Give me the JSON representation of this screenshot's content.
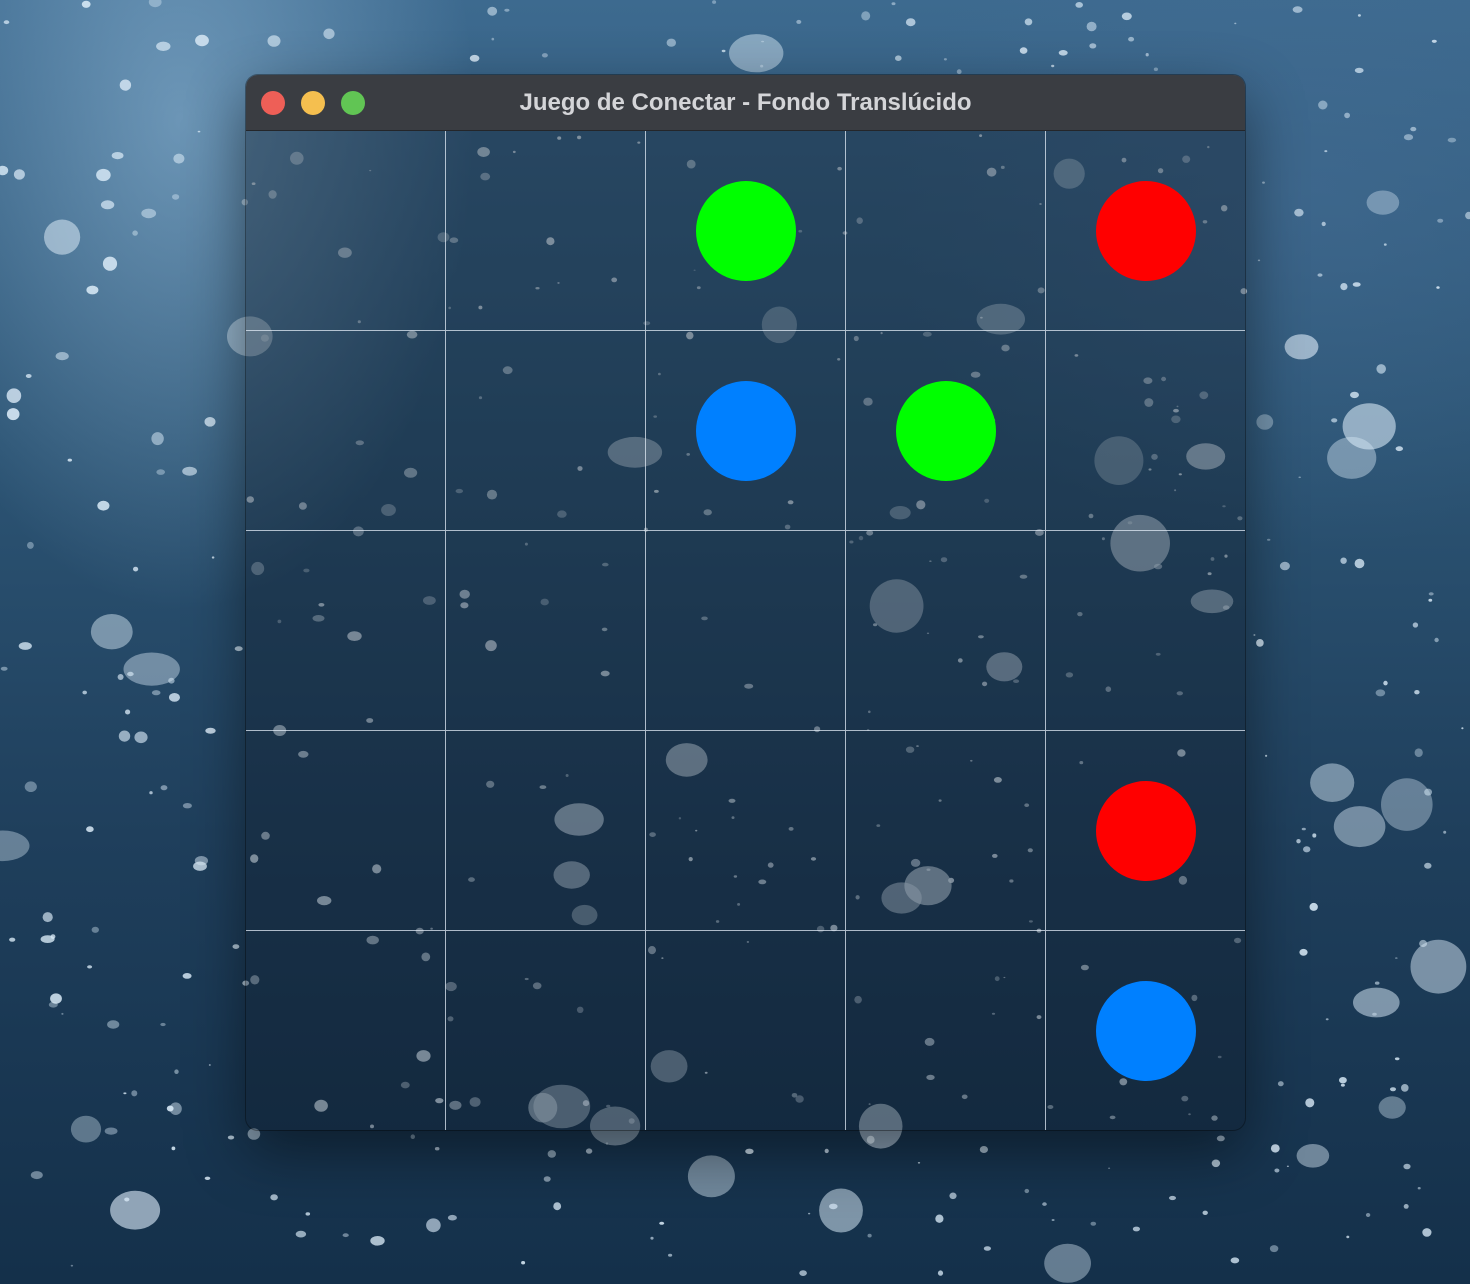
{
  "window": {
    "title": "Juego de Conectar - Fondo Translúcido"
  },
  "colors": {
    "red": "#ff0000",
    "green": "#00ff00",
    "blue": "#0080ff",
    "close": "#ee5f57",
    "minimize": "#f5bf4f",
    "maximize": "#61c554"
  },
  "board": {
    "rows": 5,
    "cols": 5,
    "dots": [
      {
        "row": 0,
        "col": 2,
        "color": "green"
      },
      {
        "row": 0,
        "col": 4,
        "color": "red"
      },
      {
        "row": 1,
        "col": 2,
        "color": "blue"
      },
      {
        "row": 1,
        "col": 3,
        "color": "green"
      },
      {
        "row": 3,
        "col": 4,
        "color": "red"
      },
      {
        "row": 4,
        "col": 4,
        "color": "blue"
      }
    ]
  }
}
